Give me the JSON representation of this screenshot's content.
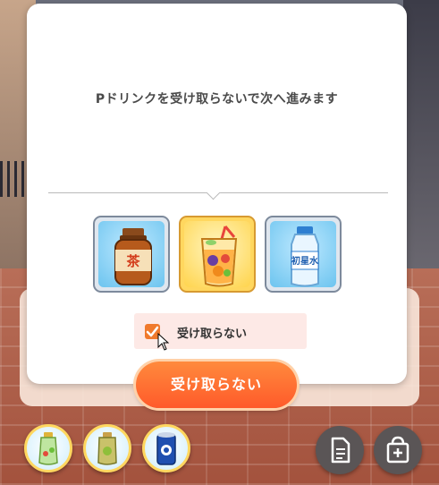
{
  "dialog": {
    "message": "Pドリンクを受け取らないで次へ進みます",
    "items": [
      {
        "icon": "tea-bottle-icon",
        "label": "茶"
      },
      {
        "icon": "juice-cup-icon"
      },
      {
        "icon": "water-bottle-icon",
        "label": "初星水"
      }
    ],
    "selected_item": 1,
    "checkbox": {
      "label": "受け取らない",
      "checked": true
    },
    "decline_button": "受け取らない"
  },
  "bottom_bar": {
    "drink_slots": [
      "green-drink-icon",
      "yellow-drink-icon",
      "blue-can-icon"
    ],
    "buttons": [
      "memo-icon",
      "shop-bag-icon"
    ]
  },
  "colors": {
    "accent": "#ff6a2f",
    "checkbox": "#f07a2c",
    "selected_border": "#d79a31"
  }
}
